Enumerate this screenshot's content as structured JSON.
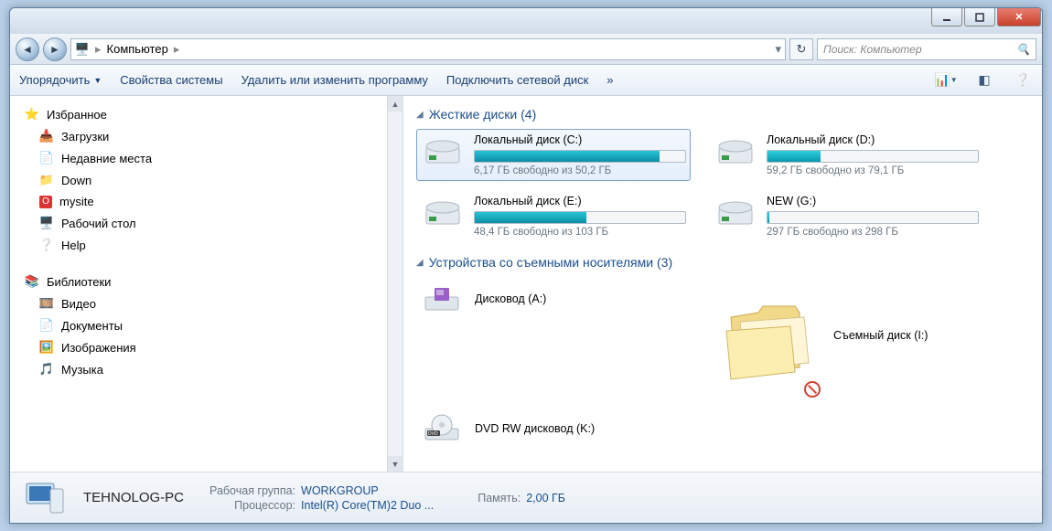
{
  "breadcrumb": {
    "icon": "computer",
    "location": "Компьютер"
  },
  "search": {
    "placeholder": "Поиск: Компьютер"
  },
  "toolbar": {
    "organize": "Упорядочить",
    "props": "Свойства системы",
    "uninstall": "Удалить или изменить программу",
    "mapdrive": "Подключить сетевой диск",
    "overflow": "»"
  },
  "sidebar": {
    "favorites": {
      "label": "Избранное",
      "items": [
        {
          "icon": "download",
          "label": "Загрузки"
        },
        {
          "icon": "recent",
          "label": "Недавние места"
        },
        {
          "icon": "folder",
          "label": "Down"
        },
        {
          "icon": "opera",
          "label": "mysite"
        },
        {
          "icon": "desktop",
          "label": "Рабочий стол"
        },
        {
          "icon": "help",
          "label": "Help"
        }
      ]
    },
    "libraries": {
      "label": "Библиотеки",
      "items": [
        {
          "icon": "video",
          "label": "Видео"
        },
        {
          "icon": "docs",
          "label": "Документы"
        },
        {
          "icon": "images",
          "label": "Изображения"
        },
        {
          "icon": "music",
          "label": "Музыка"
        }
      ]
    }
  },
  "groups": {
    "hdd": {
      "label": "Жесткие диски",
      "count": 4
    },
    "removable": {
      "label": "Устройства со съемными носителями",
      "count": 3
    }
  },
  "drives": [
    {
      "name": "Локальный диск (C:)",
      "free": "6,17 ГБ свободно из 50,2 ГБ",
      "fill_pct": 88,
      "selected": true
    },
    {
      "name": "Локальный диск (D:)",
      "free": "59,2 ГБ свободно из 79,1 ГБ",
      "fill_pct": 25,
      "selected": false
    },
    {
      "name": "Локальный диск (E:)",
      "free": "48,4 ГБ свободно из 103 ГБ",
      "fill_pct": 53,
      "selected": false
    },
    {
      "name": "NEW (G:)",
      "free": "297 ГБ свободно из 298 ГБ",
      "fill_pct": 1,
      "selected": false
    }
  ],
  "removable": [
    {
      "icon": "floppy",
      "name": "Дисковод (A:)"
    },
    {
      "icon": "folder-big",
      "name": "Съемный диск (I:)"
    },
    {
      "icon": "dvd",
      "name": "DVD RW дисковод (K:)"
    }
  ],
  "status": {
    "pcname": "TEHNOLOG-PC",
    "workgroup_k": "Рабочая группа:",
    "workgroup_v": "WORKGROUP",
    "cpu_k": "Процессор:",
    "cpu_v": "Intel(R) Core(TM)2 Duo ...",
    "mem_k": "Память:",
    "mem_v": "2,00 ГБ"
  }
}
